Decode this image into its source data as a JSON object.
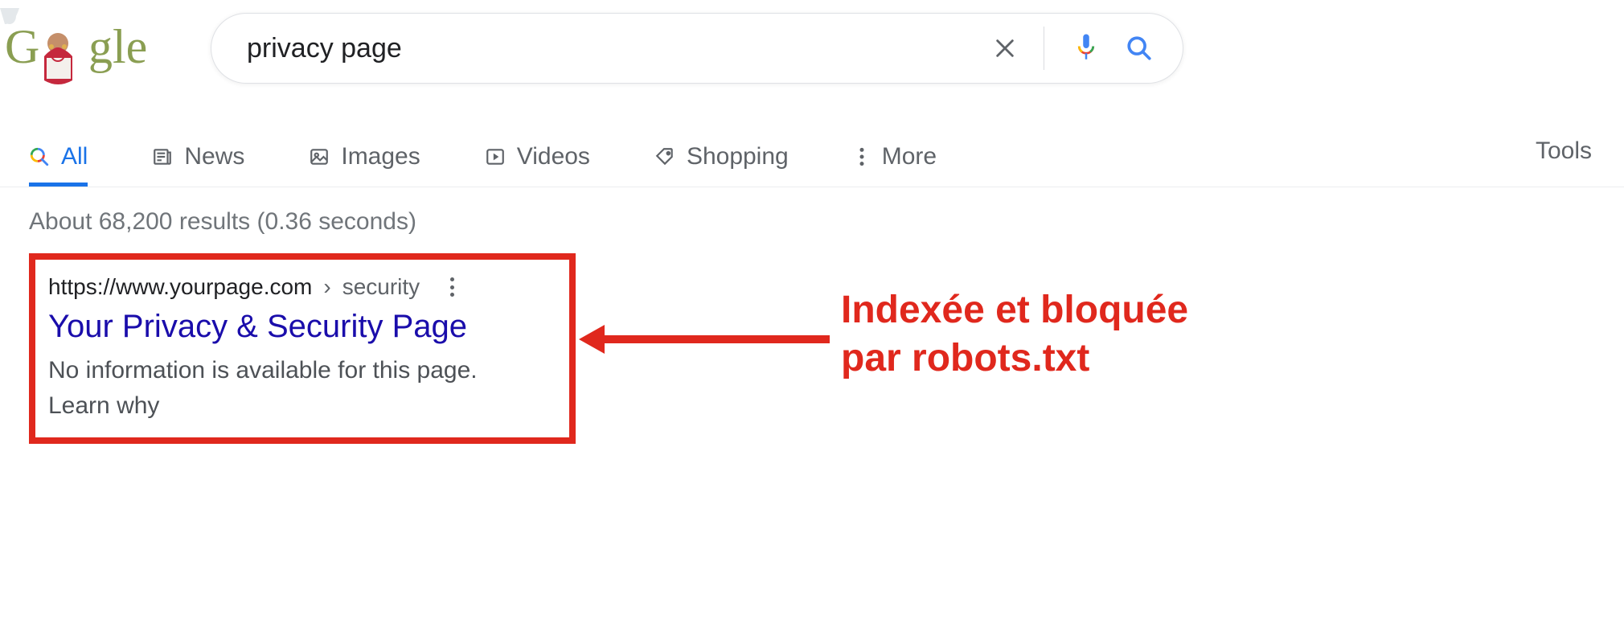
{
  "search": {
    "query": "privacy page",
    "placeholder": ""
  },
  "tabs": {
    "all": "All",
    "news": "News",
    "images": "Images",
    "videos": "Videos",
    "shopping": "Shopping",
    "more": "More",
    "tools": "Tools"
  },
  "stats": "About 68,200 results (0.36 seconds)",
  "result": {
    "url_host": "https://www.yourpage.com",
    "url_sep": " › ",
    "url_path": "security",
    "title": "Your Privacy & Security Page",
    "snippet": "No information is available for this page.",
    "learn_why": "Learn why"
  },
  "annotation": {
    "text_line1": "Indexée et bloquée",
    "text_line2": "par robots.txt"
  },
  "colors": {
    "accent": "#1a73e8",
    "link": "#1a0dab",
    "annotation_red": "#e0281d"
  },
  "icons": {
    "clear": "clear-icon",
    "mic": "mic-icon",
    "search": "search-icon",
    "news": "news-icon",
    "images": "images-icon",
    "videos": "videos-icon",
    "shopping": "shopping-icon",
    "more": "more-dots-icon",
    "result_more": "vertical-dots-icon",
    "all": "magnify-multicolor-icon"
  }
}
